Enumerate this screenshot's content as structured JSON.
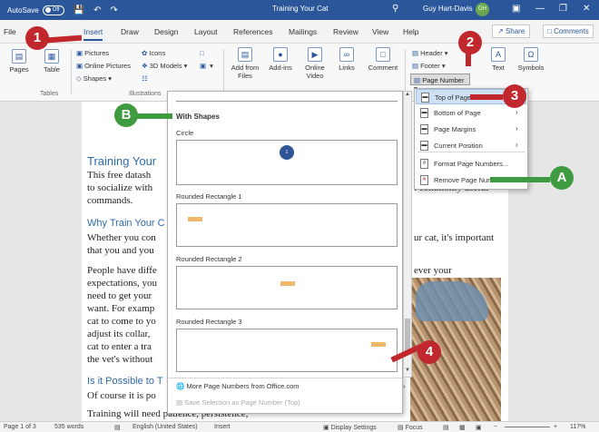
{
  "titlebar": {
    "autosave_label": "AutoSave",
    "autosave_state": "Off",
    "doc_title": "Training Your Cat",
    "user_name": "Guy Hart-Davis",
    "user_initials": "GH",
    "bg_color": "#2b579a"
  },
  "tabs": [
    "File",
    "Insert",
    "Draw",
    "Design",
    "Layout",
    "References",
    "Mailings",
    "Review",
    "View",
    "Help"
  ],
  "active_tab": "Insert",
  "share_label": "Share",
  "comments_label": "Comments",
  "ribbon": {
    "pages": "Pages",
    "table": "Table",
    "tables_group": "Tables",
    "pictures": "Pictures",
    "online_pictures": "Online Pictures",
    "shapes": "Shapes",
    "icons": "Icons",
    "models_3d": "3D Models",
    "illustrations_group": "Illustrations",
    "add_from_files": "Add from Files",
    "addins": "Add-ins",
    "online_video": "Online Video",
    "links": "Links",
    "comment": "Comment",
    "header": "Header",
    "footer": "Footer",
    "page_number": "Page Number",
    "text": "Text",
    "symbols": "Symbols"
  },
  "document": {
    "heading": "Training Your",
    "p1_line1": "This free datash",
    "p1_line2": "to socialize with",
    "p1_line3": "commands.",
    "p1_right": "t commonly useful",
    "sub1": "Why Train Your C",
    "p2_line1": "Whether you con",
    "p2_line2": "that you and you",
    "p2_right": "ur cat, it's important",
    "p3_line1": "People have diffe",
    "p3_line2": "expectations, you",
    "p3_line3": "need to get your",
    "p3_line4": "want. For examp",
    "p3_line5": "cat to come to yo",
    "p3_line6": "adjust its collar,",
    "p3_line7": "cat to enter a tra",
    "p3_line8": "the vet's without",
    "p3_right": "ever your",
    "sub2": "Is it Possible to T",
    "p4_line1": "Of course it is po",
    "p5_line1": "Training will need patience, persistence,"
  },
  "gallery": {
    "section": "With Shapes",
    "items": [
      {
        "label": "Circle",
        "number": "1"
      },
      {
        "label": "Rounded Rectangle 1"
      },
      {
        "label": "Rounded Rectangle 2"
      },
      {
        "label": "Rounded Rectangle 3"
      }
    ],
    "more": "More Page Numbers from Office.com",
    "save": "Save Selection as Page Number (Top)"
  },
  "page_number_menu": {
    "items": [
      "Top of Page",
      "Bottom of Page",
      "Page Margins",
      "Current Position",
      "Format Page Numbers...",
      "Remove Page Numbers"
    ],
    "highlighted": "Top of Page"
  },
  "callouts": {
    "c1": "1",
    "c2": "2",
    "c3": "3",
    "c4": "4",
    "cA": "A",
    "cB": "B",
    "red": "#c0282d",
    "green": "#3f9b3f"
  },
  "status": {
    "page": "Page 1 of 3",
    "words": "535 words",
    "language": "English (United States)",
    "mode": "Insert",
    "display": "Display Settings",
    "focus": "Focus",
    "zoom": "117%"
  }
}
